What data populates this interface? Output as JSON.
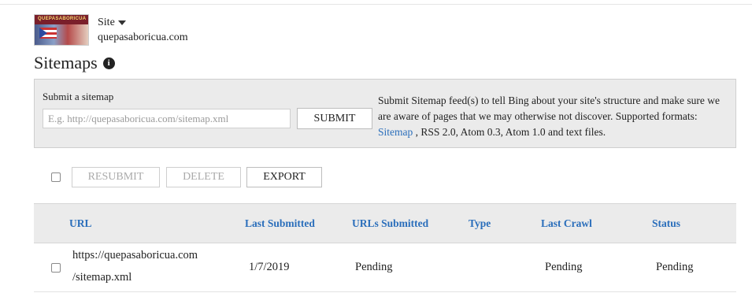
{
  "site": {
    "thumbnail_text": "QUEPASABORICUA",
    "switcher_label": "Site",
    "url": "quepasaboricua.com"
  },
  "page": {
    "title": "Sitemaps",
    "info_glyph": "i"
  },
  "submit_panel": {
    "label": "Submit a sitemap",
    "input_placeholder": "E.g. http://quepasaboricua.com/sitemap.xml",
    "input_value": "",
    "submit_label": "SUBMIT",
    "description_before": "Submit Sitemap feed(s) to tell Bing about your site's structure and make sure we are aware of pages that we may otherwise not discover. Supported formats: ",
    "description_link": "Sitemap",
    "description_after": " , RSS 2.0, Atom 0.3, Atom 1.0 and text files."
  },
  "toolbar": {
    "resubmit_label": "RESUBMIT",
    "delete_label": "DELETE",
    "export_label": "EXPORT"
  },
  "table": {
    "columns": [
      "URL",
      "Last Submitted",
      "URLs Submitted",
      "Type",
      "Last Crawl",
      "Status"
    ],
    "rows": [
      {
        "url_line1": "https://quepasaboricua.com",
        "url_line2": "/sitemap.xml",
        "last_submitted": "1/7/2019",
        "urls_submitted": "Pending",
        "type": "",
        "last_crawl": "Pending",
        "status": "Pending"
      }
    ]
  },
  "colors": {
    "link_blue": "#2a6ebb",
    "panel_gray": "#ebebeb",
    "disabled_text": "#aaaaaa"
  }
}
